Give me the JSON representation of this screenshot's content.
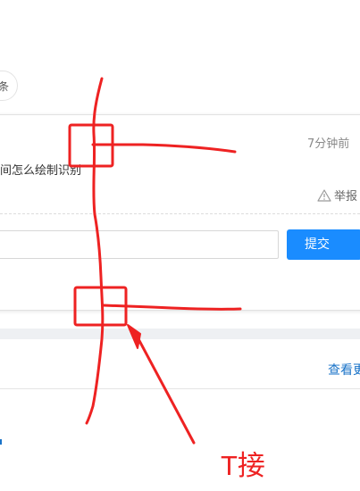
{
  "top_pill": {
    "label": "条"
  },
  "comment_card": {
    "timestamp": "7分钟前",
    "comment_text": "间怎么绘制识别",
    "report_label": "举报",
    "reply_input": {
      "value": "",
      "placeholder": ""
    },
    "submit_label": "提交"
  },
  "next_section": {
    "view_more_label": "查看更"
  },
  "annotation": {
    "label": "T接",
    "stroke_color": "#ee2222",
    "icons": [
      "warning-triangle-icon"
    ]
  }
}
